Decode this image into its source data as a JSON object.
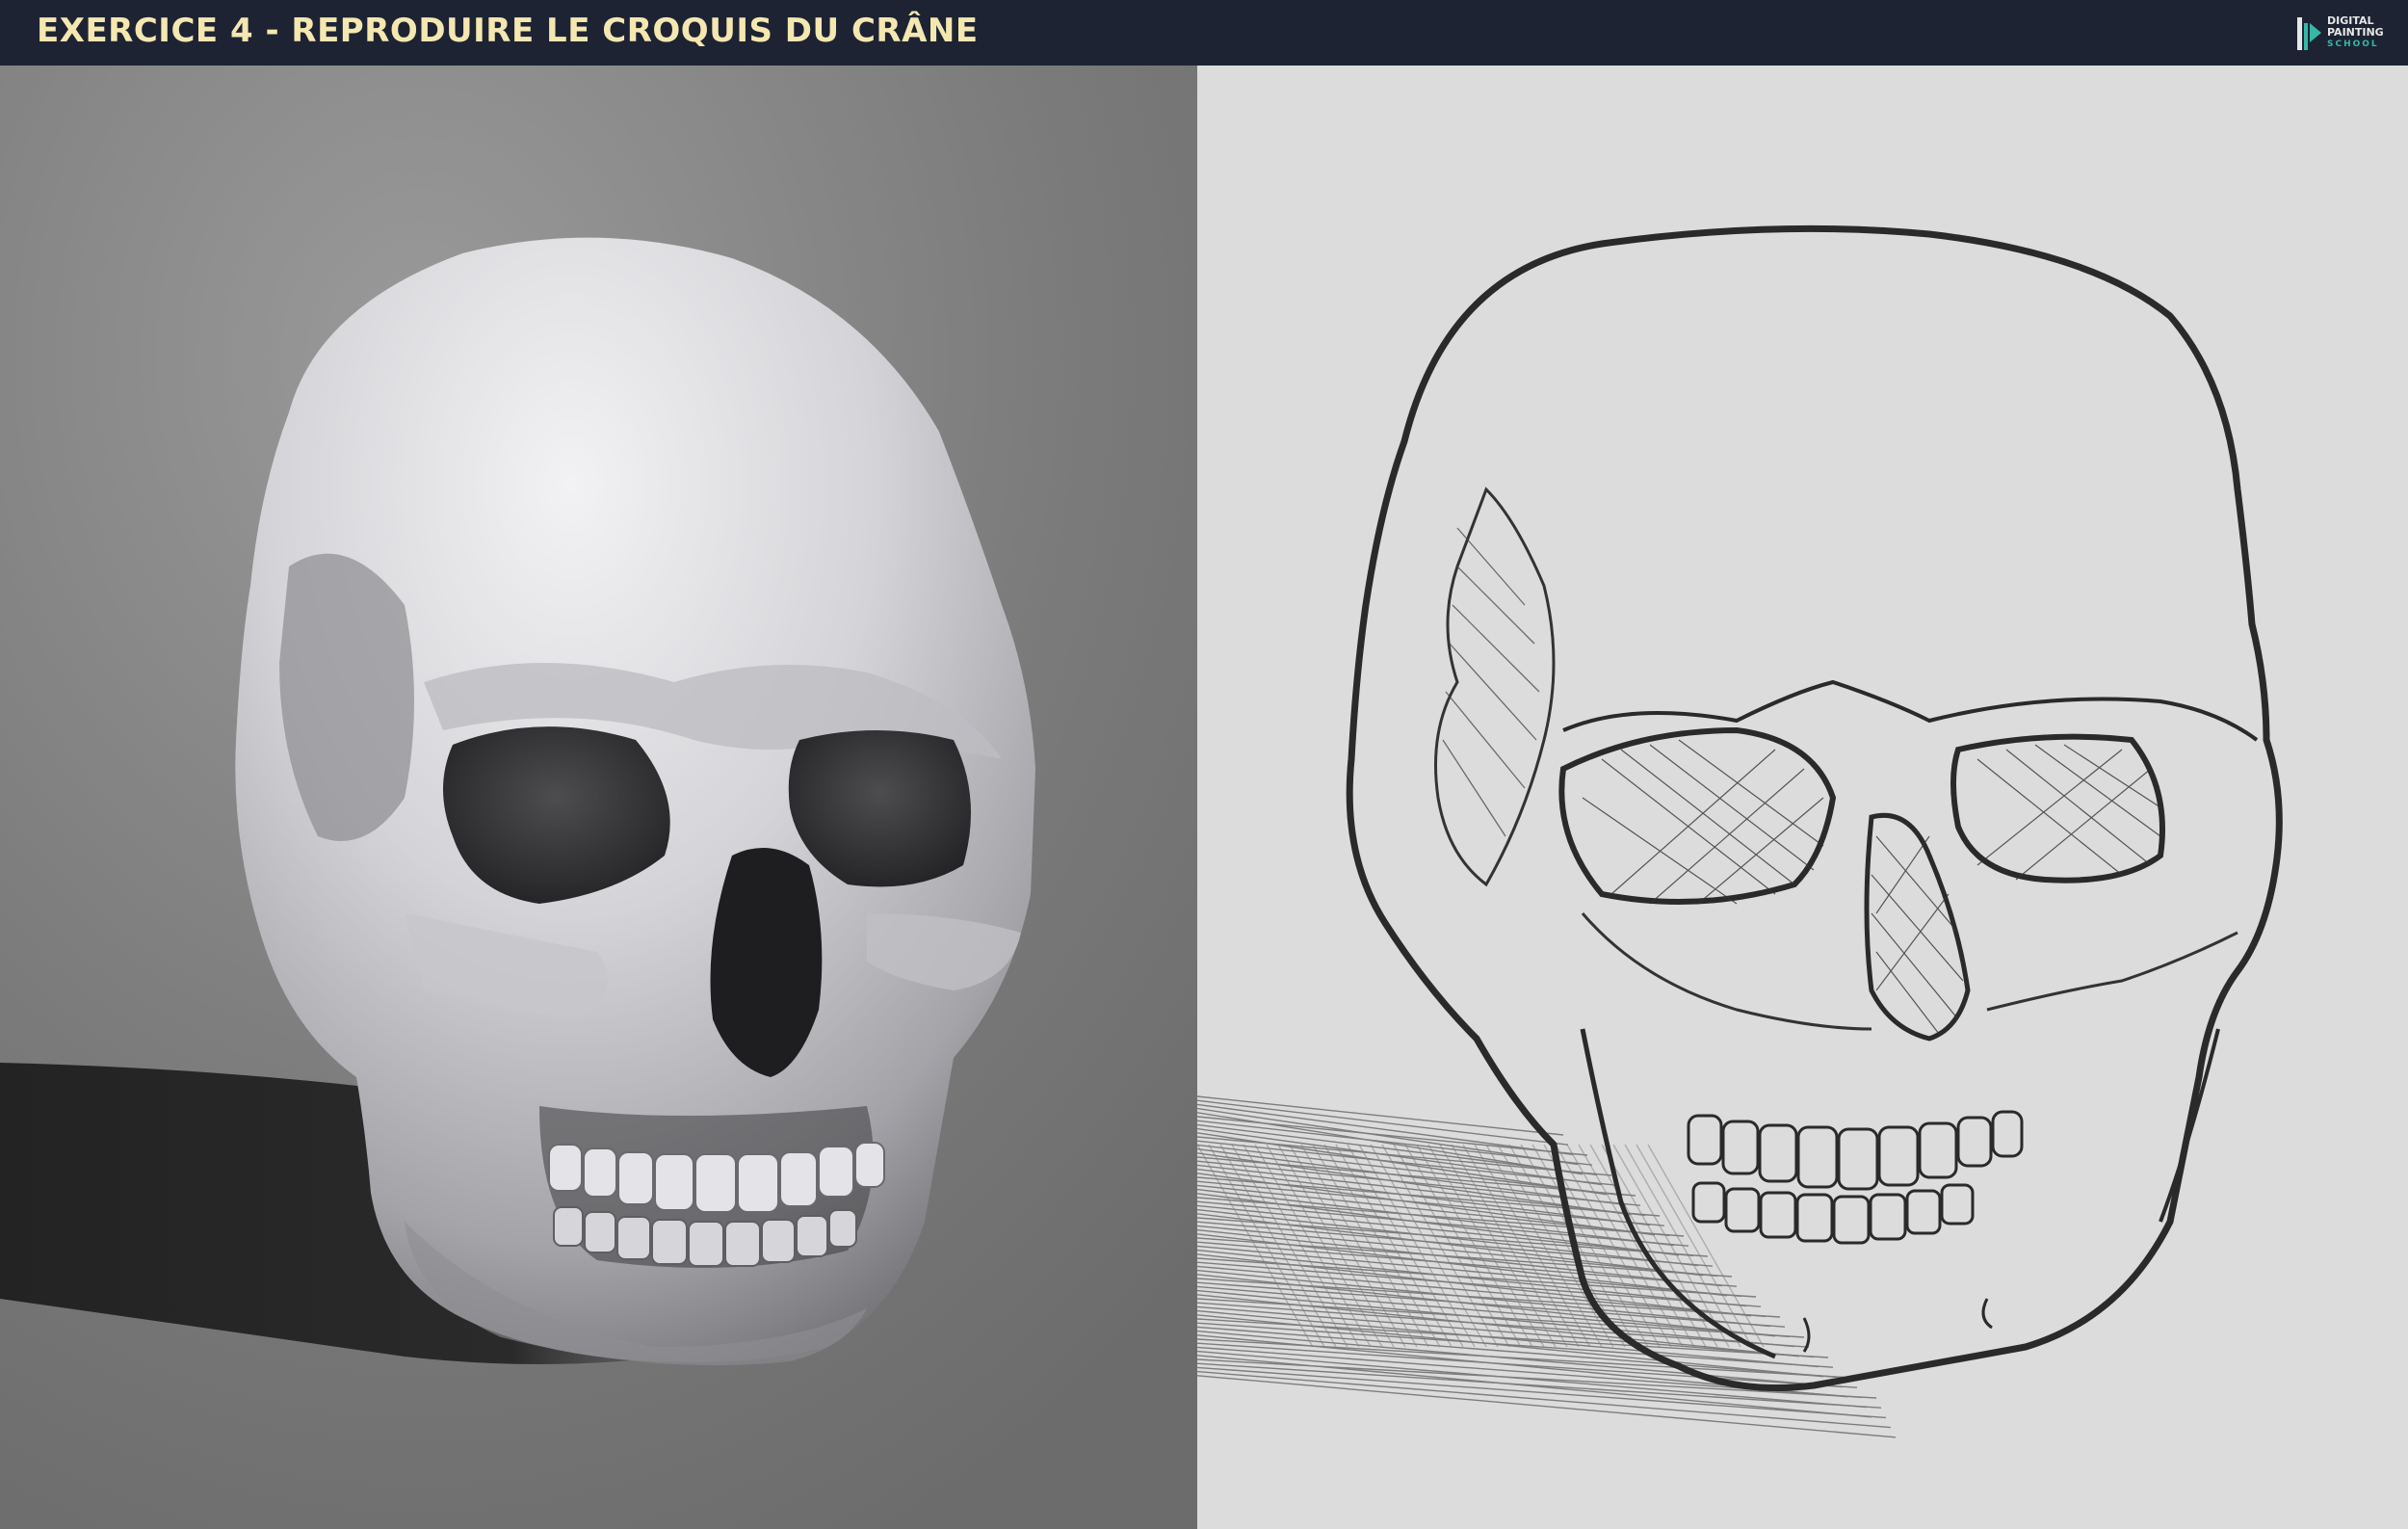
{
  "header": {
    "title": "EXERCICE 4 - REPRODUIRE LE CROQUIS DU CRÂNE",
    "logo": {
      "line1": "DIGITAL",
      "line2": "PAINTING",
      "line3": "SCHOOL",
      "icon": "pen-nib-logo-icon"
    }
  },
  "colors": {
    "header_bg": "#1d2333",
    "title_text": "#f4e7b0",
    "logo_accent": "#37b7a8",
    "photo_bg": "#7b7b7b",
    "sketch_bg": "#dcdcdc",
    "ink": "#2a2a2a"
  },
  "panels": {
    "left": "skull-photo-reference",
    "right": "skull-line-sketch"
  }
}
